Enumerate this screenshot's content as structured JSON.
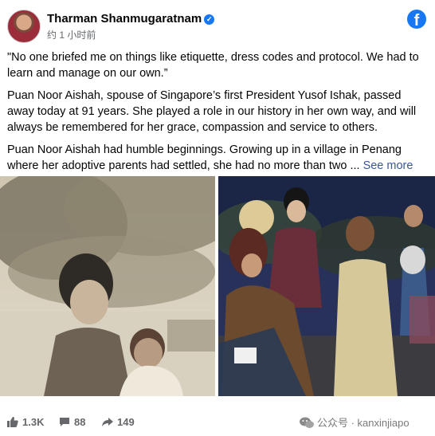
{
  "post": {
    "author": "Tharman Shanmugaratnam",
    "timestamp": "约 1 小时前",
    "paragraphs": [
      "\"No one briefed me on things like etiquette, dress codes and protocol. We had to learn and manage on our own.”",
      "Puan Noor Aishah, spouse of Singapore’s first President Yusof Ishak, passed away today at 91 years. She played a role in our history in her own way, and will always be remembered for her grace, compassion and service to others.",
      "Puan Noor Aishah had humble beginnings. Growing up in a village in Penang where her adoptive parents had settled, she had no more than two ..."
    ],
    "see_more": "See more"
  },
  "stats": {
    "likes": "1.3K",
    "comments": "88",
    "shares": "149"
  },
  "watermark": "公众号 · kanxinjiapo",
  "colors": {
    "facebook_blue": "#1877f2",
    "link": "#385898",
    "muted": "#65676b"
  },
  "icons": [
    "verified-badge-icon",
    "facebook-logo-icon",
    "like-icon",
    "comment-icon",
    "share-icon",
    "wechat-icon"
  ]
}
